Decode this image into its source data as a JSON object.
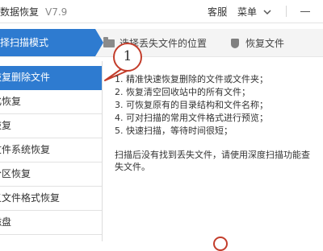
{
  "app": {
    "title": "数据恢复",
    "version": "V7.9"
  },
  "titlebar": {
    "service_label": "客服",
    "menu_label": "菜单",
    "menu_icon": "chevron-down-icon",
    "minimize_icon": "minimize-icon"
  },
  "steps": [
    {
      "label": "选择扫描模式",
      "state": "active"
    },
    {
      "label": "选择丢失文件的位置",
      "icon": "folder-icon"
    },
    {
      "label": "恢复文件",
      "icon": "shield-icon"
    }
  ],
  "sidebar": {
    "items": [
      {
        "label": "恢复删除文件",
        "active": true
      },
      {
        "label": "化恢复"
      },
      {
        "label": "恢复"
      },
      {
        "label": "文件系统恢复"
      },
      {
        "label": "分区恢复"
      },
      {
        "label": "义文件格式恢复"
      },
      {
        "label": "磁盘"
      }
    ]
  },
  "callout": {
    "number": "1"
  },
  "description": {
    "lines": [
      "1. 精准快速恢复删除的文件或文件夹；",
      "2. 恢复清空回收站中的所有文件；",
      "3. 可恢复原有的目录结构和文件名称；",
      "4. 可对扫描的常用文件格式进行预览；",
      "5. 快速扫描，等待时间很短；"
    ],
    "note_lines": [
      "扫描后没有找到丢失文件，请使用深度扫描功能查",
      "失文件。"
    ]
  },
  "colors": {
    "accent": "#2e7bd0",
    "callout": "#c33d2b"
  }
}
